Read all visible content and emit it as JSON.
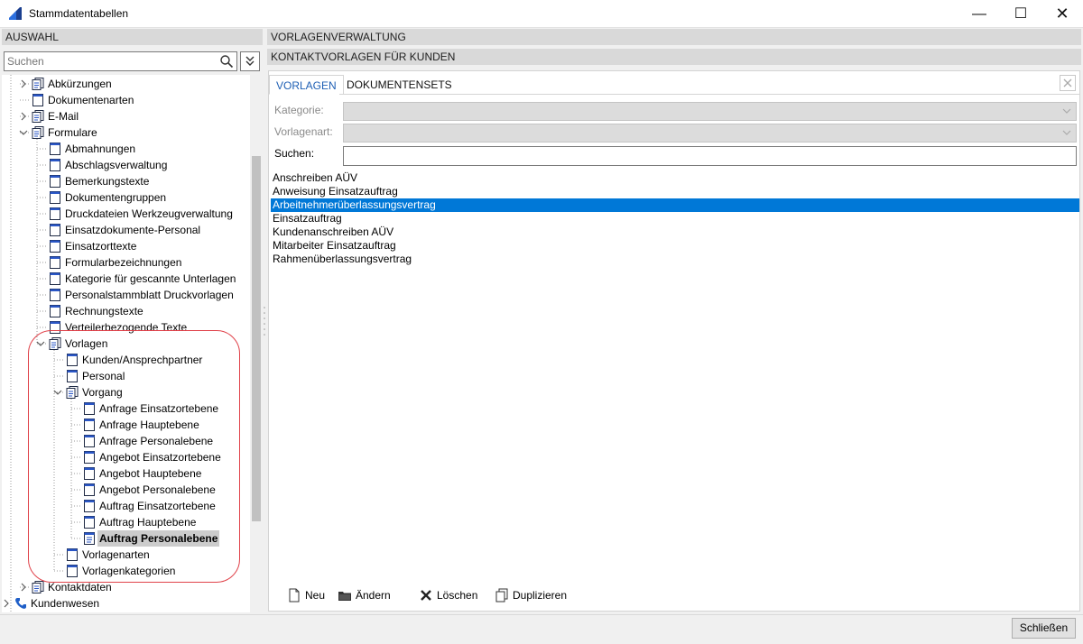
{
  "window": {
    "title": "Stammdatentabellen",
    "minimize": "—",
    "maximize": "☐",
    "close": "✕"
  },
  "left": {
    "header": "AUSWAHL",
    "search_placeholder": "Suchen",
    "filter_icon": "chevron-double-down-icon"
  },
  "tree": {
    "nodes": [
      {
        "label": "Abkürzungen",
        "toggle": "›",
        "icon": "folder-documents-icon"
      },
      {
        "label": "Dokumentenarten",
        "toggle": "",
        "icon": "document-icon"
      },
      {
        "label": "E-Mail",
        "toggle": "›",
        "icon": "folder-documents-icon"
      },
      {
        "label": "Formulare",
        "toggle": "⌄",
        "icon": "folder-documents-icon"
      },
      {
        "label": "Abmahnungen",
        "toggle": "",
        "icon": "document-icon"
      },
      {
        "label": "Abschlagsverwaltung",
        "toggle": "",
        "icon": "document-icon"
      },
      {
        "label": "Bemerkungstexte",
        "toggle": "",
        "icon": "document-icon"
      },
      {
        "label": "Dokumentengruppen",
        "toggle": "",
        "icon": "document-icon"
      },
      {
        "label": "Druckdateien Werkzeugverwaltung",
        "toggle": "",
        "icon": "document-icon"
      },
      {
        "label": "Einsatzdokumente-Personal",
        "toggle": "",
        "icon": "document-icon"
      },
      {
        "label": "Einsatzorttexte",
        "toggle": "",
        "icon": "document-icon"
      },
      {
        "label": "Formularbezeichnungen",
        "toggle": "",
        "icon": "document-icon"
      },
      {
        "label": "Kategorie für gescannte Unterlagen",
        "toggle": "",
        "icon": "document-icon"
      },
      {
        "label": "Personalstammblatt Druckvorlagen",
        "toggle": "",
        "icon": "document-icon"
      },
      {
        "label": "Rechnungstexte",
        "toggle": "",
        "icon": "document-icon"
      },
      {
        "label": "Verteilerbezogende Texte",
        "toggle": "",
        "icon": "document-icon"
      },
      {
        "label": "Vorlagen",
        "toggle": "⌄",
        "icon": "folder-documents-icon"
      },
      {
        "label": "Kunden/Ansprechpartner",
        "toggle": "",
        "icon": "document-icon"
      },
      {
        "label": "Personal",
        "toggle": "",
        "icon": "document-icon"
      },
      {
        "label": "Vorgang",
        "toggle": "⌄",
        "icon": "folder-documents-icon"
      },
      {
        "label": "Anfrage Einsatzortebene",
        "toggle": "",
        "icon": "document-icon"
      },
      {
        "label": "Anfrage Hauptebene",
        "toggle": "",
        "icon": "document-icon"
      },
      {
        "label": "Anfrage Personalebene",
        "toggle": "",
        "icon": "document-icon"
      },
      {
        "label": "Angebot Einsatzortebene",
        "toggle": "",
        "icon": "document-icon"
      },
      {
        "label": "Angebot Hauptebene",
        "toggle": "",
        "icon": "document-icon"
      },
      {
        "label": "Angebot Personalebene",
        "toggle": "",
        "icon": "document-icon"
      },
      {
        "label": "Auftrag Einsatzortebene",
        "toggle": "",
        "icon": "document-icon"
      },
      {
        "label": "Auftrag Hauptebene",
        "toggle": "",
        "icon": "document-icon"
      },
      {
        "label": "Auftrag Personalebene",
        "toggle": "",
        "icon": "document-text-icon",
        "selected": true
      },
      {
        "label": "Vorlagenarten",
        "toggle": "",
        "icon": "document-icon"
      },
      {
        "label": "Vorlagenkategorien",
        "toggle": "",
        "icon": "document-icon"
      },
      {
        "label": "Kontaktdaten",
        "toggle": "›",
        "icon": "folder-documents-icon"
      },
      {
        "label": "Kundenwesen",
        "toggle": "›",
        "icon": "phone-icon"
      }
    ]
  },
  "right": {
    "header": "VORLAGENVERWALTUNG",
    "subheader": "KONTAKTVORLAGEN FÜR KUNDEN",
    "tabs": [
      {
        "label": "VORLAGEN",
        "active": true
      },
      {
        "label": "DOKUMENTENSETS",
        "active": false
      }
    ],
    "tabs_close_icon": "close-icon",
    "filters": {
      "kategorie_label": "Kategorie:",
      "vorlagenart_label": "Vorlagenart:",
      "suchen_label": "Suchen:"
    },
    "templates": [
      "Anschreiben AÜV",
      "Anweisung Einsatzauftrag",
      "Arbeitnehmerüberlassungsvertrag",
      "Einsatzauftrag",
      "Kundenanschreiben AÜV",
      "Mitarbeiter Einsatzauftrag",
      "Rahmenüberlassungsvertrag"
    ],
    "selected_template": "Arbeitnehmerüberlassungsvertrag",
    "actions": [
      {
        "label": "Neu",
        "icon": "new-document-icon"
      },
      {
        "label": "Ändern",
        "icon": "folder-icon"
      },
      {
        "label": "Löschen",
        "icon": "delete-x-icon"
      },
      {
        "label": "Duplizieren",
        "icon": "duplicate-icon"
      }
    ]
  },
  "footer": {
    "close_label": "Schließen"
  },
  "colors": {
    "selection": "#0078d7",
    "tab_active_text": "#1e5fb4",
    "highlight_ring": "#e0424a",
    "tree_selected": "#cccccc"
  }
}
